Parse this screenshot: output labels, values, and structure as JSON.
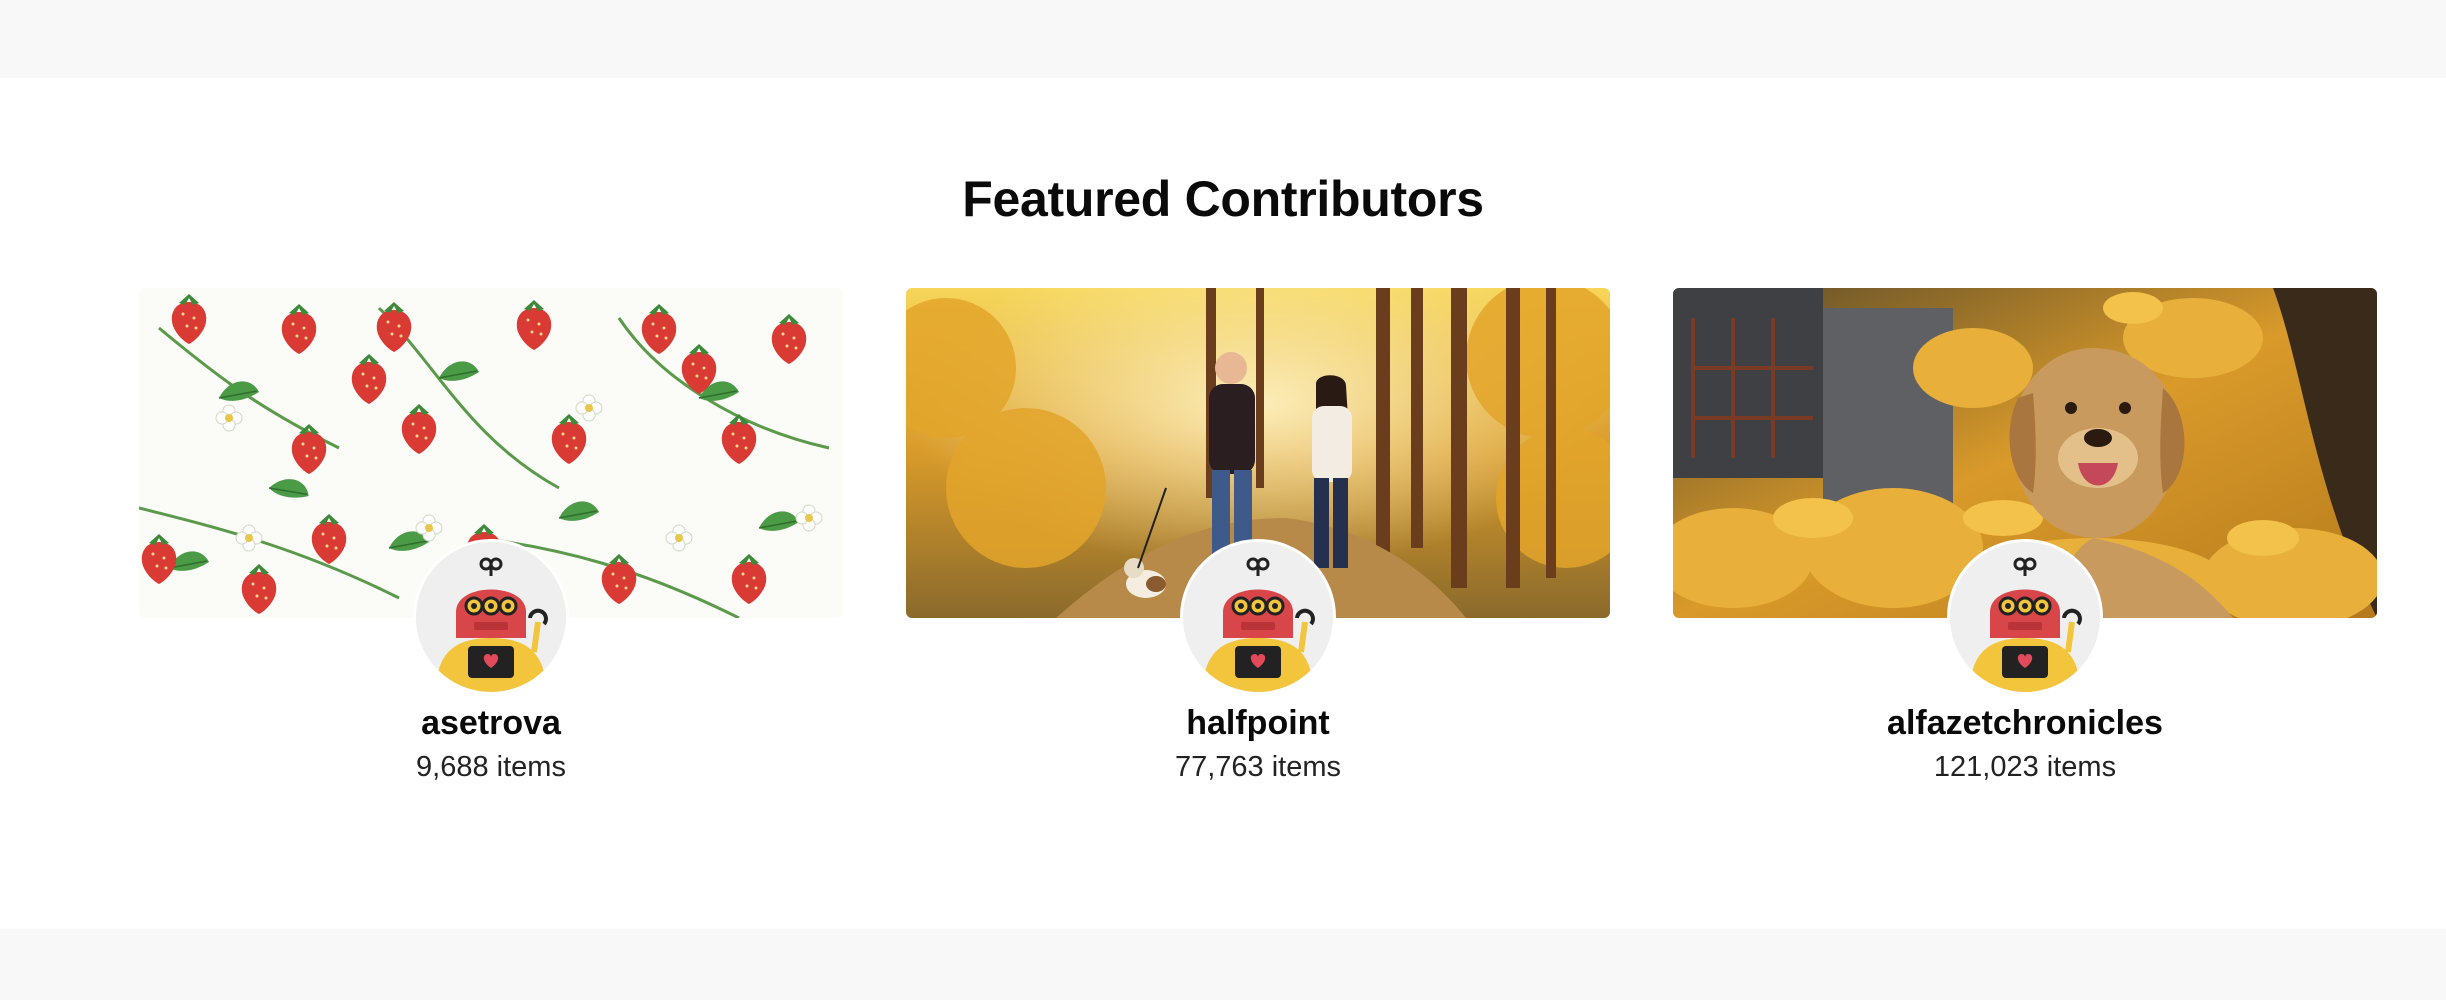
{
  "section": {
    "title": "Featured Contributors"
  },
  "contributors": [
    {
      "name": "asetrova",
      "items": "9,688 items",
      "banner": "strawberry-pattern",
      "avatar": "robot-avatar-icon"
    },
    {
      "name": "halfpoint",
      "items": "77,763 items",
      "banner": "autumn-couple-walking-dog",
      "avatar": "robot-avatar-icon"
    },
    {
      "name": "alfazetchronicles",
      "items": "121,023 items",
      "banner": "golden-retriever-in-leaves",
      "avatar": "robot-avatar-icon"
    }
  ],
  "colors": {
    "band": "#f8f8f8",
    "text": "#0a0a0a",
    "robot_red": "#d9464a",
    "robot_yellow": "#f3c53c"
  }
}
